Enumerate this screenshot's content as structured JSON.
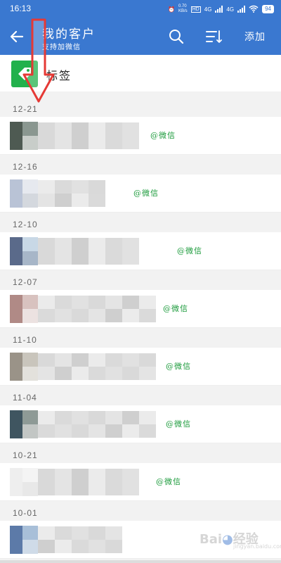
{
  "status_bar": {
    "time": "16:13",
    "speed": "0.70\nKB/s",
    "network_1": "4G",
    "network_2": "4G",
    "battery": "94"
  },
  "header": {
    "title": "我的客户",
    "subtitle": "支持加微信",
    "add_label": "添加",
    "back_icon": "back-arrow-icon",
    "search_icon": "search-icon",
    "sort_icon": "sort-icon"
  },
  "tag_row": {
    "label": "标签",
    "icon": "tag-icon"
  },
  "groups": [
    {
      "date": "12-21",
      "contact": {
        "suffix": "@微信"
      }
    },
    {
      "date": "12-16",
      "contact": {
        "suffix": "@微信"
      }
    },
    {
      "date": "12-10",
      "contact": {
        "suffix": "@微信"
      }
    },
    {
      "date": "12-07",
      "contact": {
        "suffix": "@微信"
      }
    },
    {
      "date": "11-10",
      "contact": {
        "suffix": "@微信"
      }
    },
    {
      "date": "11-04",
      "contact": {
        "suffix": "@微信"
      }
    },
    {
      "date": "10-21",
      "contact": {
        "suffix": "@微信"
      }
    },
    {
      "date": "10-01",
      "contact": {
        "suffix": ""
      }
    }
  ],
  "colors": {
    "primary": "#3a78d0",
    "tag_green": "#22b14c",
    "wechat_green": "#1a9a3a",
    "annotation_red": "#e53935"
  }
}
